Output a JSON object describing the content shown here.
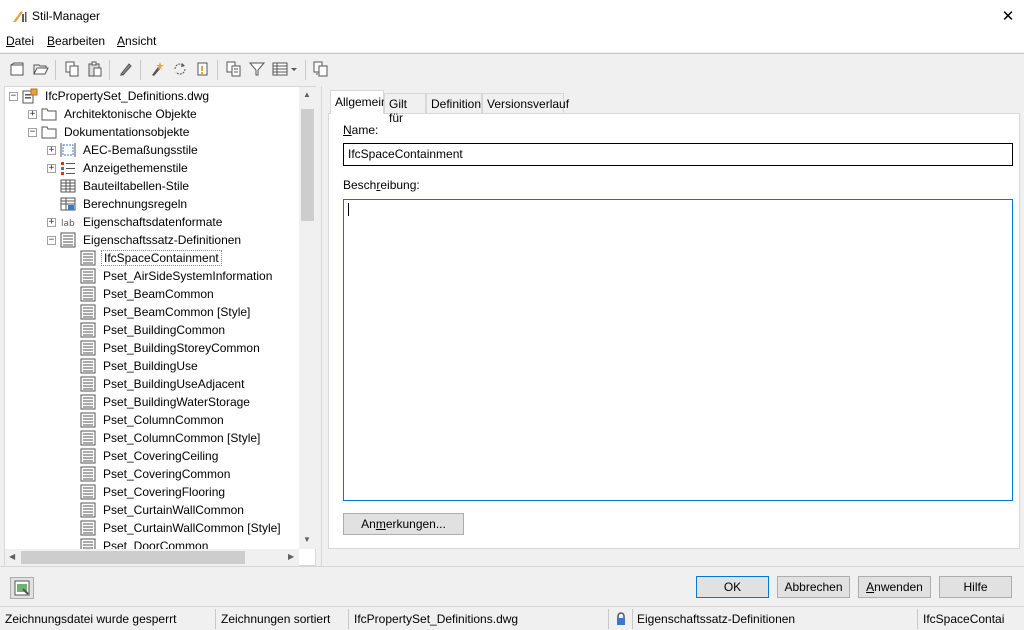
{
  "window": {
    "title": "Stil-Manager",
    "close_glyph": "✕"
  },
  "menu": [
    {
      "label": "Datei",
      "accel": "D",
      "rest": "atei"
    },
    {
      "label": "Bearbeiten",
      "accel": "B",
      "rest": "earbeiten"
    },
    {
      "label": "Ansicht",
      "accel": "A",
      "rest": "nsicht"
    }
  ],
  "toolbar": {
    "icons": [
      "new-drawing-icon",
      "open-drawing-icon",
      "copy-icon",
      "paste-icon",
      "edit-icon",
      "purge-icon",
      "sync-icon",
      "update-icon",
      "filter-view-icon",
      "filter-icon",
      "view-mode-icon",
      "toggle-view-icon"
    ]
  },
  "tree": {
    "root": "IfcPropertySet_Definitions.dwg",
    "level1": [
      {
        "label": "Architektonische Objekte",
        "expander": "+"
      },
      {
        "label": "Dokumentationsobjekte",
        "expander": "−"
      }
    ],
    "level2": [
      {
        "label": "AEC-Bemaßungsstile",
        "expander": "+",
        "icon": "dimension-style-icon"
      },
      {
        "label": "Anzeigethemenstile",
        "expander": "+",
        "icon": "display-theme-icon"
      },
      {
        "label": "Bauteiltabellen-Stile",
        "expander": "",
        "icon": "schedule-table-icon"
      },
      {
        "label": "Berechnungsregeln",
        "expander": "",
        "icon": "calculation-rule-icon"
      },
      {
        "label": "Eigenschaftsdatenformate",
        "expander": "+",
        "icon": "data-format-icon"
      },
      {
        "label": "Eigenschaftssatz-Definitionen",
        "expander": "−",
        "icon": "property-set-icon"
      }
    ],
    "psets": [
      "IfcSpaceContainment",
      "Pset_AirSideSystemInformation",
      "Pset_BeamCommon",
      "Pset_BeamCommon [Style]",
      "Pset_BuildingCommon",
      "Pset_BuildingStoreyCommon",
      "Pset_BuildingUse",
      "Pset_BuildingUseAdjacent",
      "Pset_BuildingWaterStorage",
      "Pset_ColumnCommon",
      "Pset_ColumnCommon [Style]",
      "Pset_CoveringCeiling",
      "Pset_CoveringCommon",
      "Pset_CoveringFlooring",
      "Pset_CurtainWallCommon",
      "Pset_CurtainWallCommon [Style]",
      "Pset_DoorCommon"
    ],
    "selected": "IfcSpaceContainment"
  },
  "tabs": [
    "Allgemein",
    "Gilt für",
    "Definition",
    "Versionsverlauf"
  ],
  "general": {
    "name_label_accel": "N",
    "name_label_rest": "ame:",
    "name_value": "IfcSpaceContainment",
    "desc_label_a": "Besch",
    "desc_label_accel": "r",
    "desc_label_b": "eibung:",
    "desc_value": "",
    "notes_button_a": "An",
    "notes_button_accel": "m",
    "notes_button_b": "erkungen..."
  },
  "buttons": {
    "ok": "OK",
    "cancel": "Abbrechen",
    "apply_accel": "A",
    "apply_rest": "nwenden",
    "help": "Hilfe"
  },
  "status": {
    "lock_state": "Zeichnungsdatei wurde gesperrt",
    "sort_state": "Zeichnungen sortiert",
    "file": "IfcPropertySet_Definitions.dwg",
    "category": "Eigenschaftssatz-Definitionen",
    "style": "IfcSpaceContai"
  }
}
